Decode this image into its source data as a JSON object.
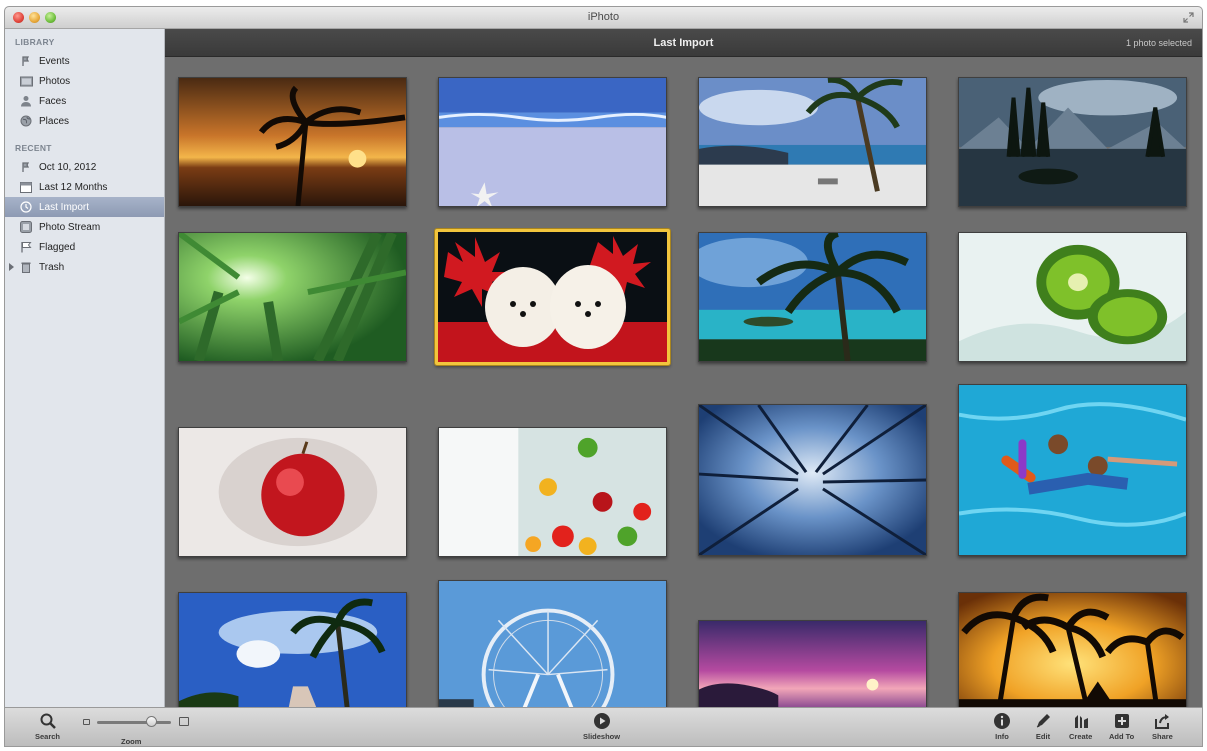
{
  "window": {
    "title": "iPhoto"
  },
  "sidebar": {
    "library_heading": "LIBRARY",
    "library_items": [
      {
        "label": "Events",
        "icon": "events-icon"
      },
      {
        "label": "Photos",
        "icon": "photos-icon"
      },
      {
        "label": "Faces",
        "icon": "faces-icon"
      },
      {
        "label": "Places",
        "icon": "places-icon"
      }
    ],
    "recent_heading": "RECENT",
    "recent_items": [
      {
        "label": "Oct 10, 2012",
        "icon": "event-pin-icon"
      },
      {
        "label": "Last 12 Months",
        "icon": "calendar-icon"
      },
      {
        "label": "Last Import",
        "icon": "clock-icon",
        "selected": true
      },
      {
        "label": "Photo Stream",
        "icon": "photo-stream-icon"
      },
      {
        "label": "Flagged",
        "icon": "flag-icon"
      },
      {
        "label": "Trash",
        "icon": "trash-icon"
      }
    ]
  },
  "header": {
    "title": "Last Import",
    "status": "1 photo selected"
  },
  "photos": [
    {
      "subject": "tropical sunset with palm tree"
    },
    {
      "subject": "beach with starfish"
    },
    {
      "subject": "beach with palm trees and lounge chairs"
    },
    {
      "subject": "mountain lake with pine trees"
    },
    {
      "subject": "sunlight through bamboo forest"
    },
    {
      "subject": "two white puppies with red flowers",
      "selected": true
    },
    {
      "subject": "palm tree over lagoon"
    },
    {
      "subject": "kiwi splash"
    },
    {
      "subject": "apple splash"
    },
    {
      "subject": "fruit in bubbling water"
    },
    {
      "subject": "looking up at winter trees"
    },
    {
      "subject": "children in swimming pool"
    },
    {
      "subject": "palm trees under blue sky"
    },
    {
      "subject": "ferris wheel"
    },
    {
      "subject": "purple sunset over water"
    },
    {
      "subject": "palm silhouettes at golden sunset"
    }
  ],
  "toolbar": {
    "search": "Search",
    "zoom": "Zoom",
    "slideshow": "Slideshow",
    "info": "Info",
    "edit": "Edit",
    "create": "Create",
    "add_to": "Add To",
    "share": "Share"
  },
  "colors": {
    "selection": "#f2c53d",
    "sidebar_bg": "#e2e6ec",
    "grid_bg": "#6e6e6e"
  }
}
